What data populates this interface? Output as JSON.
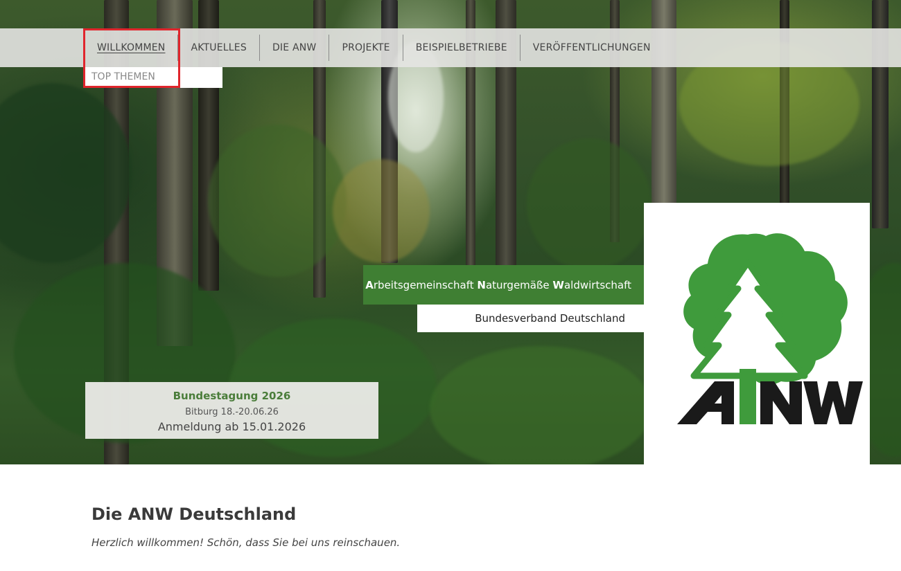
{
  "nav": {
    "items": [
      {
        "label": "WILLKOMMEN",
        "active": true
      },
      {
        "label": "AKTUELLES"
      },
      {
        "label": "DIE ANW"
      },
      {
        "label": "PROJEKTE"
      },
      {
        "label": "BEISPIELBETRIEBE"
      },
      {
        "label": "VERÖFFENTLICHUNGEN"
      }
    ],
    "submenu": {
      "label": "TOP THEMEN"
    }
  },
  "hero": {
    "tagline": {
      "part1_initial": "A",
      "part1_rest": "rbeitsgemeinschaft ",
      "part2_initial": "N",
      "part2_rest": "aturgemäße ",
      "part3_initial": "W",
      "part3_rest": "aldwirtschaft",
      "subline": "Bundesverband Deutschland"
    },
    "event": {
      "title": "Bundestagung 2026",
      "place_date": "Bitburg 18.-20.06.26",
      "registration": "Anmeldung ab 15.01.2026"
    },
    "logo": {
      "text": "ANW",
      "colors": {
        "green": "#3f9b3c",
        "black": "#1a1a1a"
      }
    }
  },
  "content": {
    "title": "Die ANW Deutschland",
    "welcome": "Herzlich willkommen! Schön, dass Sie bei uns reinschauen."
  },
  "colors": {
    "accent_green": "#3f7f33",
    "event_title": "#4a7d3a",
    "highlight": "#e0252c"
  }
}
